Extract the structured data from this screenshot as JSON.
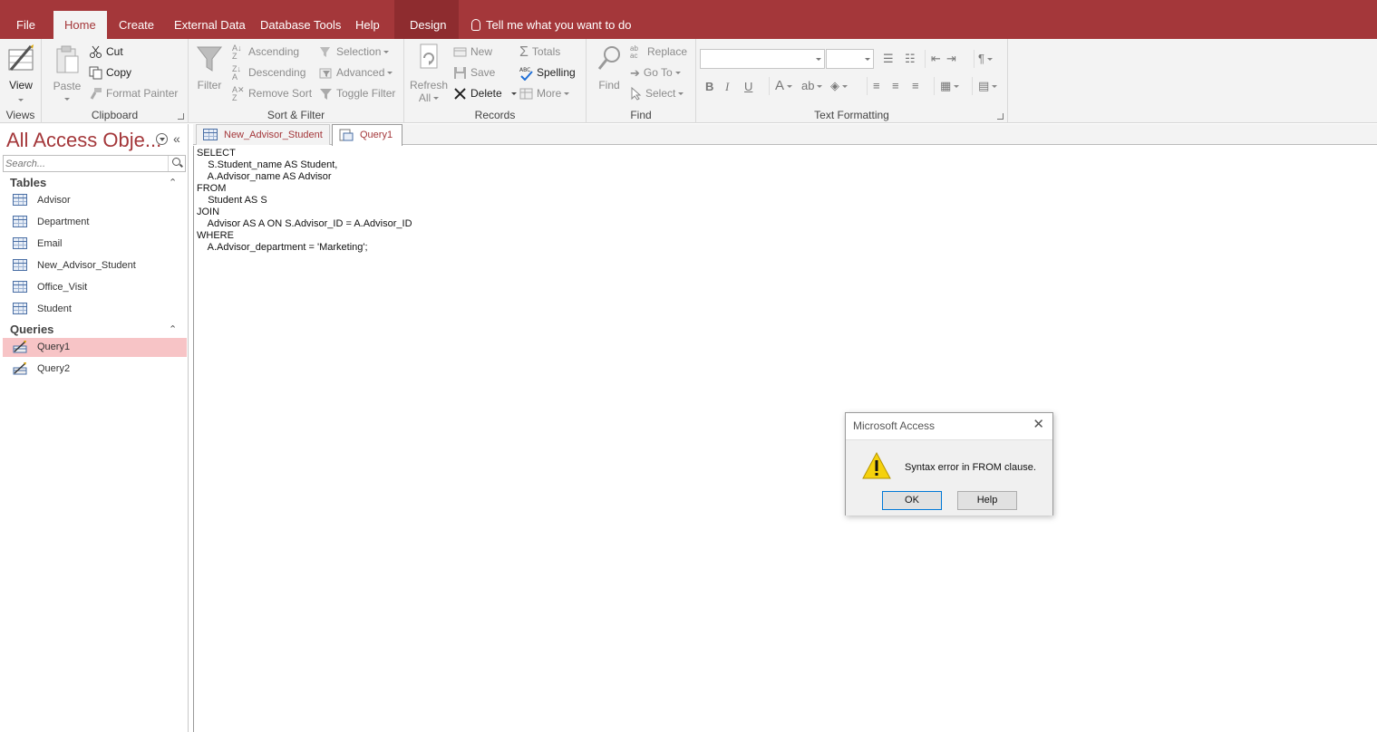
{
  "menu": {
    "tabs": [
      {
        "label": "File"
      },
      {
        "label": "Home"
      },
      {
        "label": "Create"
      },
      {
        "label": "External Data"
      },
      {
        "label": "Database Tools"
      },
      {
        "label": "Help"
      },
      {
        "label": "Design"
      }
    ],
    "tell_me": "Tell me what you want to do"
  },
  "ribbon": {
    "views": {
      "label": "Views",
      "view": "View"
    },
    "clipboard": {
      "label": "Clipboard",
      "paste": "Paste",
      "cut": "Cut",
      "copy": "Copy",
      "format_painter": "Format Painter"
    },
    "sort_filter": {
      "label": "Sort & Filter",
      "filter": "Filter",
      "ascending": "Ascending",
      "descending": "Descending",
      "remove_sort": "Remove Sort",
      "selection": "Selection",
      "advanced": "Advanced",
      "toggle_filter": "Toggle Filter"
    },
    "records": {
      "label": "Records",
      "refresh": "Refresh",
      "refresh_all": "All",
      "new": "New",
      "save": "Save",
      "delete": "Delete",
      "totals": "Totals",
      "spelling": "Spelling",
      "more": "More"
    },
    "find": {
      "label": "Find",
      "find": "Find",
      "replace": "Replace",
      "go_to": "Go To",
      "select": "Select"
    },
    "text_formatting": {
      "label": "Text Formatting",
      "bold": "B",
      "italic": "I",
      "underline": "U",
      "font_color": "A"
    }
  },
  "nav": {
    "title": "All Access Obje...",
    "search_placeholder": "Search...",
    "tables_header": "Tables",
    "tables": [
      "Advisor",
      "Department",
      "Email",
      "New_Advisor_Student",
      "Office_Visit",
      "Student"
    ],
    "queries_header": "Queries",
    "queries": [
      "Query1",
      "Query2"
    ]
  },
  "doc_tabs": [
    {
      "label": "New_Advisor_Student"
    },
    {
      "label": "Query1"
    }
  ],
  "sql": "SELECT\n    S.Student_name AS Student,\n    A.Advisor_name AS Advisor\nFROM\n    Student AS S\nJOIN\n    Advisor AS A ON S.Advisor_ID = A.Advisor_ID\nWHERE\n    A.Advisor_department = 'Marketing';",
  "dialog": {
    "title": "Microsoft Access",
    "message": "Syntax error in FROM clause.",
    "ok": "OK",
    "help": "Help"
  },
  "colors": {
    "accent": "#a4373a",
    "selected_row": "#f7c4c6"
  }
}
